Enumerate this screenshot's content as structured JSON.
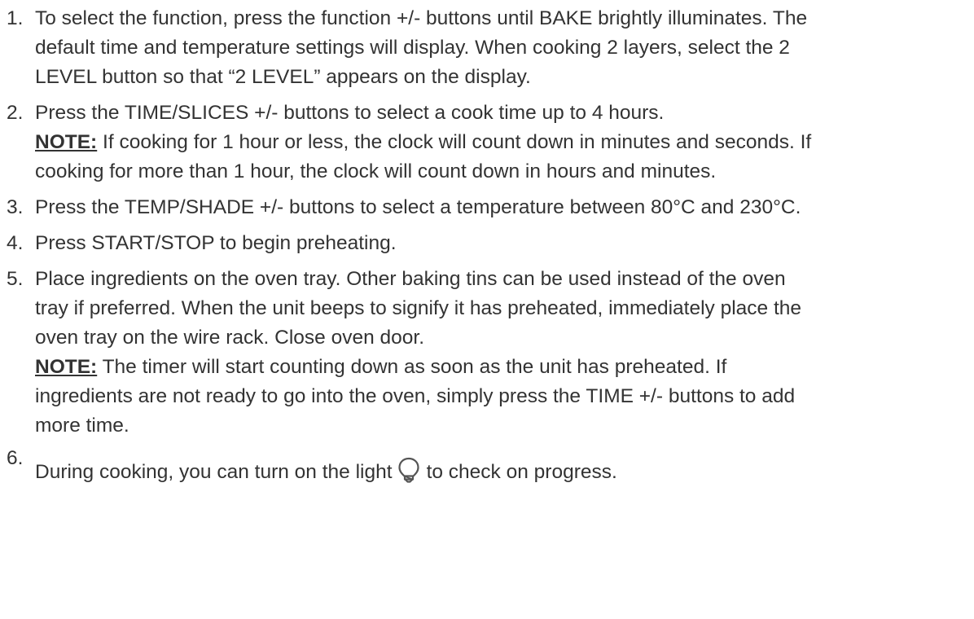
{
  "steps": [
    {
      "number": "1.",
      "lines": [
        "To select the function, press the function +/- buttons until BAKE brightly illuminates. The",
        "default time and temperature settings will display. When cooking 2 layers, select the 2",
        "LEVEL button so that “2 LEVEL” appears on the display."
      ]
    },
    {
      "number": "2.",
      "lines": [
        "Press the TIME/SLICES +/- buttons to select a cook time up to 4 hours."
      ],
      "note_label": "NOTE:",
      "note_lines": [
        " If cooking for 1 hour or less, the clock will count down in minutes and seconds. If",
        "cooking for more than 1 hour, the clock will count down in hours and minutes."
      ]
    },
    {
      "number": "3.",
      "lines": [
        "Press the TEMP/SHADE +/- buttons to select a temperature between 80°C and 230°C."
      ]
    },
    {
      "number": "4.",
      "lines": [
        "Press START/STOP to begin preheating."
      ]
    },
    {
      "number": "5.",
      "lines": [
        "Place ingredients on the oven tray. Other baking tins can be used instead of the oven",
        "tray if preferred. When the unit beeps to signify it has preheated, immediately place the",
        "oven tray on the wire rack. Close oven door."
      ],
      "note_label": "NOTE:",
      "note_lines": [
        " The timer will start counting down as soon as the unit has preheated. If",
        "ingredients are not ready to go into the oven, simply press the TIME +/- buttons to add",
        "more time."
      ]
    },
    {
      "number": "6.",
      "text_before_icon": "During cooking, you can turn on the light",
      "icon": "lightbulb-icon",
      "text_after_icon": "to check on progress."
    }
  ]
}
